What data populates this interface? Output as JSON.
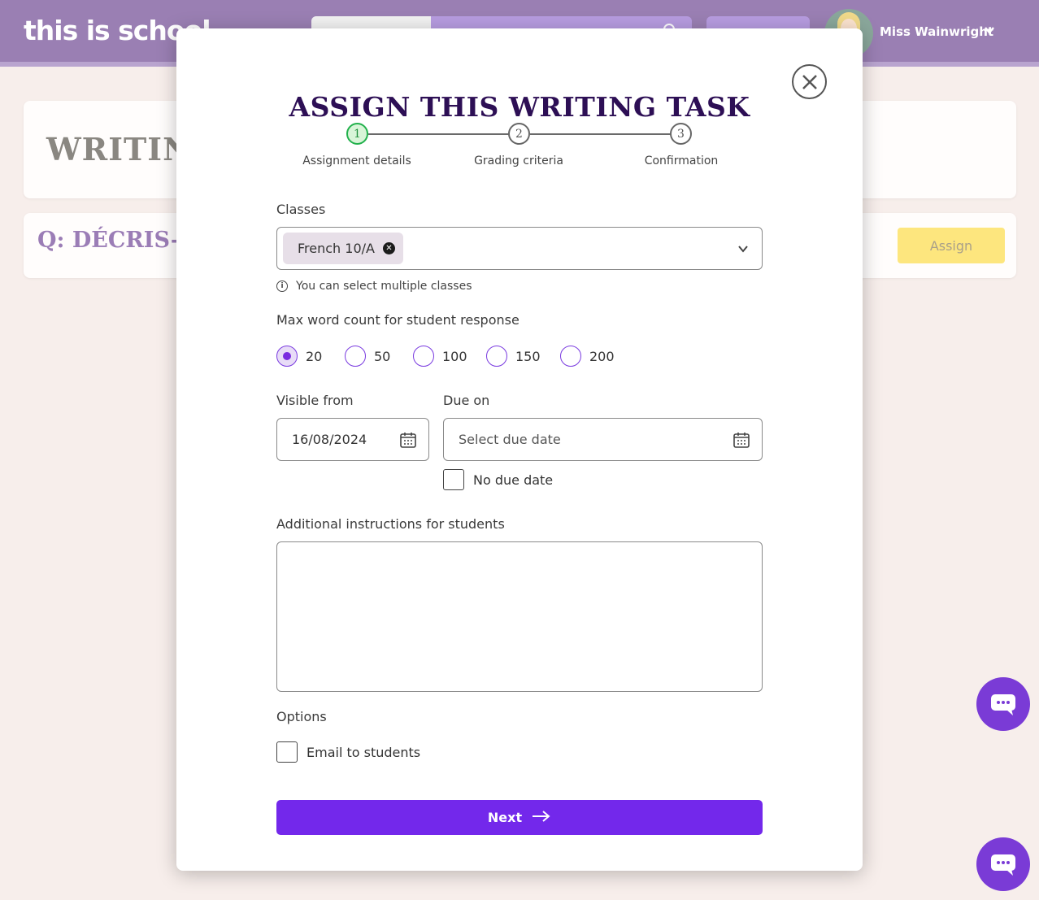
{
  "background": {
    "logo": "this is school",
    "user_name": "Miss Wainwright",
    "card_title": "WRITIN",
    "question_prefix": "Q: DÉCRIS-",
    "assign_label": "Assign"
  },
  "modal": {
    "title": "ASSIGN THIS WRITING TASK",
    "steps": [
      {
        "number": "1",
        "label": "Assignment details",
        "active": true
      },
      {
        "number": "2",
        "label": "Grading criteria",
        "active": false
      },
      {
        "number": "3",
        "label": "Confirmation",
        "active": false
      }
    ],
    "classes": {
      "label": "Classes",
      "selected_chip": "French 10/A",
      "hint": "You can select multiple classes"
    },
    "word_count": {
      "label": "Max word count for student response",
      "options": [
        "20",
        "50",
        "100",
        "150",
        "200"
      ],
      "selected": "20"
    },
    "visible_from": {
      "label": "Visible from",
      "value": "16/08/2024"
    },
    "due_on": {
      "label": "Due on",
      "placeholder": "Select due date",
      "no_due_date_label": "No due date"
    },
    "instructions": {
      "label": "Additional instructions for students",
      "value": ""
    },
    "options": {
      "label": "Options",
      "email_label": "Email to students"
    },
    "next_label": "Next"
  },
  "colors": {
    "topbar": "#9a7fb3",
    "accent": "#7328eb",
    "title": "#2d0f55",
    "step_active": "#22b14c",
    "assign_button": "#fde67e"
  }
}
